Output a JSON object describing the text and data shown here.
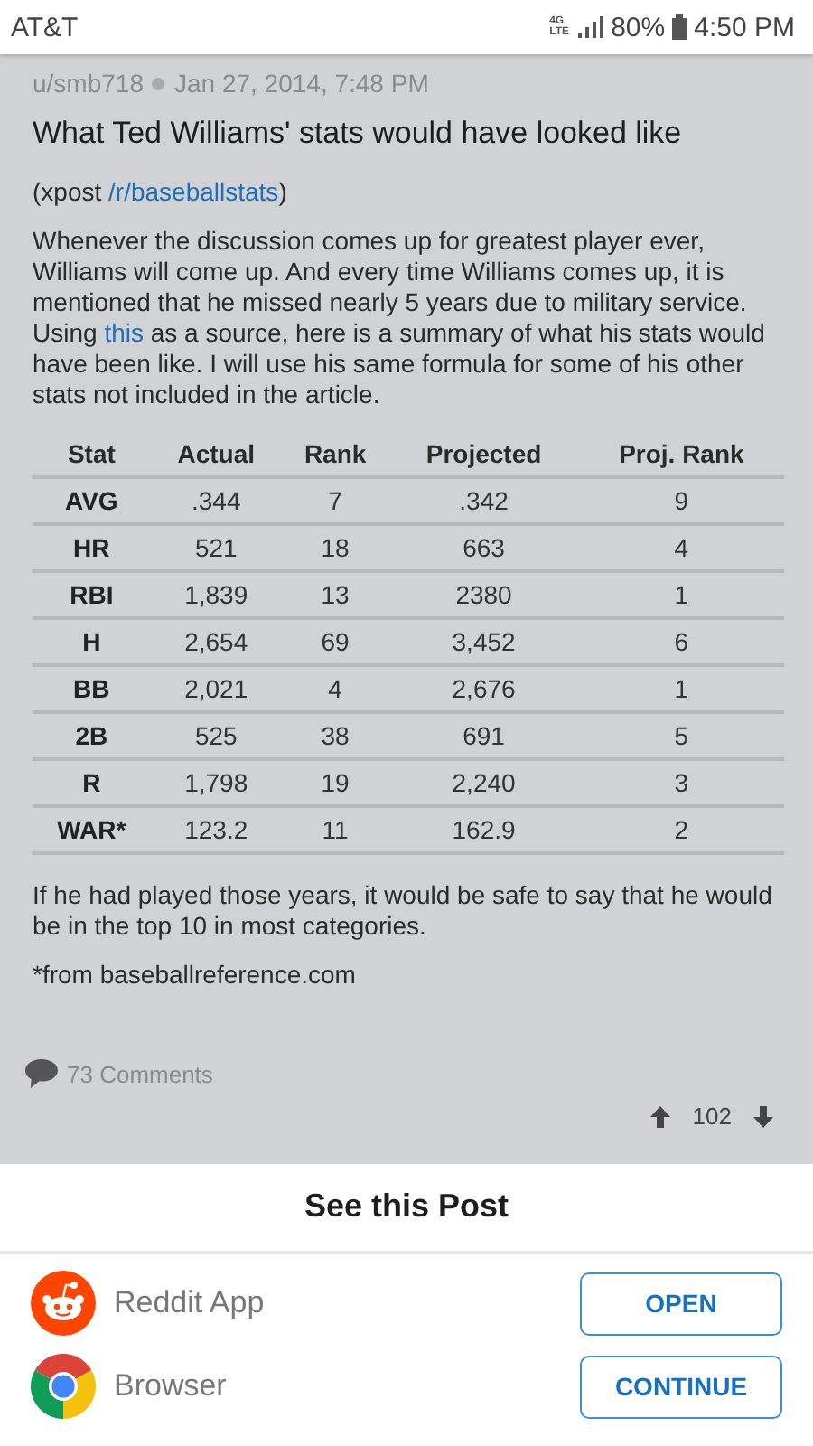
{
  "status_bar": {
    "carrier": "AT&T",
    "network": "4G LTE",
    "battery": "80%",
    "time": "4:50 PM"
  },
  "post": {
    "author": "u/smb718",
    "date": "Jan 27, 2014, 7:48 PM",
    "title": "What Ted Williams' stats would have looked like",
    "xpost": [
      {
        "kind": "text",
        "text": "(xpost "
      },
      {
        "kind": "link",
        "text": "/r/baseballstats"
      },
      {
        "kind": "text",
        "text": ")"
      }
    ],
    "body": [
      {
        "kind": "text",
        "text": "Whenever the discussion comes up for greatest player ever, Williams will come up. And every time Williams comes up, it is mentioned that he missed nearly 5 years due to military service. Using "
      },
      {
        "kind": "link",
        "text": "this"
      },
      {
        "kind": "text",
        "text": " as a source, here is a summary of what his stats would have been like. I will use his same formula for some of his other stats not included in the article."
      }
    ],
    "table": {
      "columns": [
        "Stat",
        "Actual",
        "Rank",
        "Projected",
        "Proj. Rank"
      ],
      "rows": [
        [
          "AVG",
          ".344",
          "7",
          ".342",
          "9"
        ],
        [
          "HR",
          "521",
          "18",
          "663",
          "4"
        ],
        [
          "RBI",
          "1,839",
          "13",
          "2380",
          "1"
        ],
        [
          "H",
          "2,654",
          "69",
          "3,452",
          "6"
        ],
        [
          "BB",
          "2,021",
          "4",
          "2,676",
          "1"
        ],
        [
          "2B",
          "525",
          "38",
          "691",
          "5"
        ],
        [
          "R",
          "1,798",
          "19",
          "2,240",
          "3"
        ],
        [
          "WAR*",
          "123.2",
          "11",
          "162.9",
          "2"
        ]
      ]
    },
    "after": [
      "If he had played those years, it would be safe to say that he would be in the top 10 in most categories.",
      "*from baseballreference.com"
    ],
    "comments": "73 Comments",
    "score": "102"
  },
  "sheet": {
    "title": "See this Post",
    "options": [
      {
        "kind": "reddit",
        "label": "Reddit App",
        "button": "OPEN"
      },
      {
        "kind": "browser",
        "label": "Browser",
        "button": "CONTINUE"
      }
    ]
  }
}
